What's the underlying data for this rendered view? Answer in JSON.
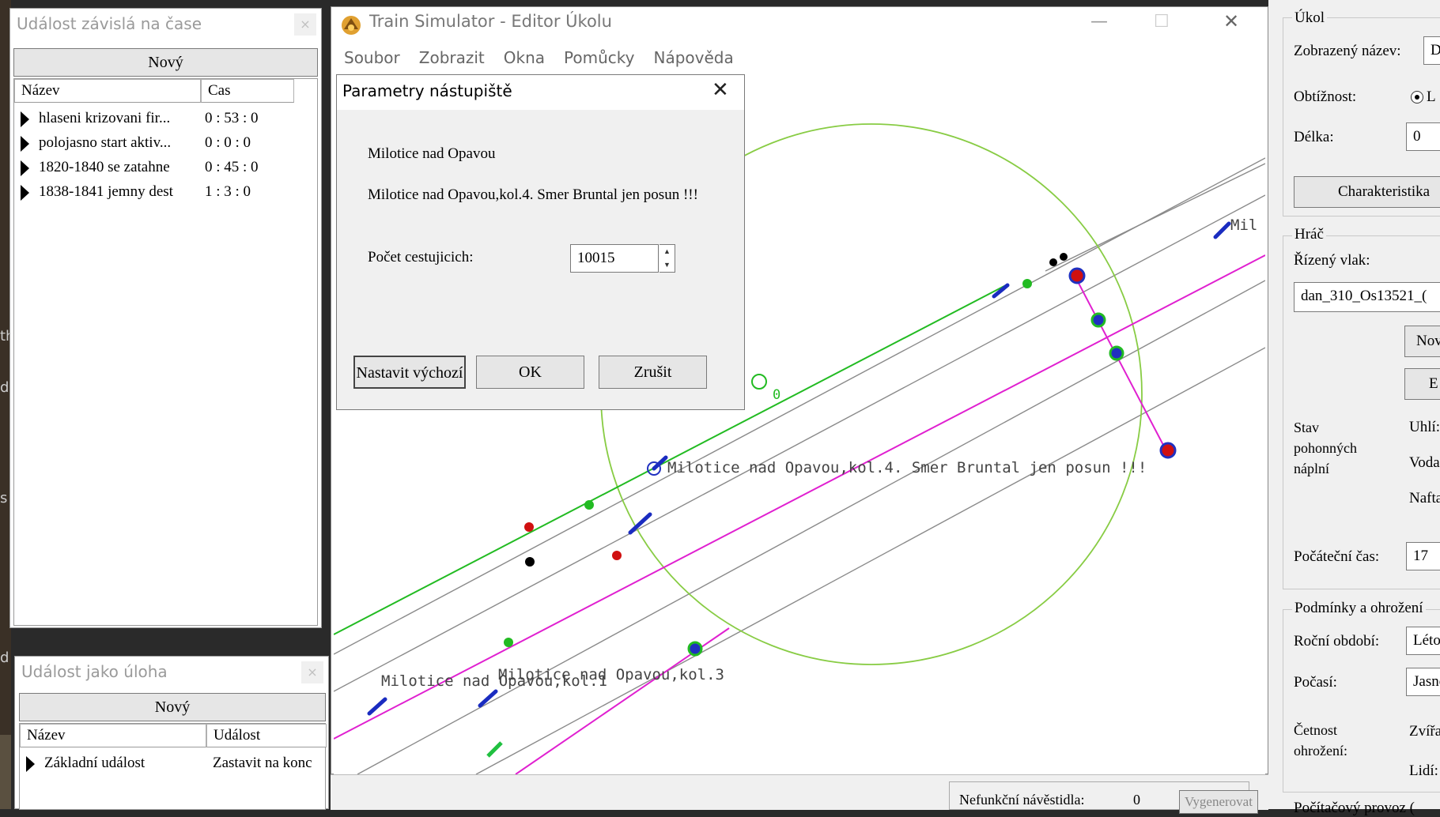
{
  "time_event_window": {
    "title": "Událost závislá na čase",
    "close_label": "×",
    "new_button": "Nový",
    "columns": [
      "Název",
      "Cas"
    ],
    "rows": [
      {
        "name": "hlaseni krizovani fir...",
        "time": "0 : 53 : 0"
      },
      {
        "name": "polojasno start aktiv...",
        "time": "0 : 0 : 0"
      },
      {
        "name": "1820-1840 se zatahne",
        "time": "0 : 45 : 0"
      },
      {
        "name": "1838-1841 jemny dest",
        "time": "1 : 3 : 0"
      }
    ]
  },
  "task_event_window": {
    "title": "Událost jako úloha",
    "close_label": "×",
    "new_button": "Nový",
    "columns": [
      "Název",
      "Událost"
    ],
    "rows": [
      {
        "name": "Základní událost",
        "event": "Zastavit na konc"
      }
    ]
  },
  "background_texts": {
    "left_edge_a": "d",
    "left_edge_b": "th",
    "left_edge_c": "s",
    "left_edge_d": "d"
  },
  "main_window": {
    "title": "Train Simulator - Editor Úkolu",
    "minimize": "—",
    "maximize": "☐",
    "close": "✕",
    "menu": [
      "Soubor",
      "Zobrazit",
      "Okna",
      "Pomůcky",
      "Nápověda"
    ]
  },
  "map": {
    "labels": {
      "platform_4": "Milotice nad Opavou,kol.4. Smer Bruntal jen posun !!!",
      "platform_3": "Milotice nad Opavou,kol.3",
      "platform_1": "Milotice nad Opavou,kol.1",
      "right_clip": "Mil",
      "zero": "0"
    },
    "colors": {
      "green": "#22bb22",
      "magenta": "#e020d0",
      "grey": "#8a8a8a",
      "circle": "#88cc44",
      "blue": "#2030c0",
      "red": "#d01010"
    }
  },
  "platform_dialog": {
    "title": "Parametry nástupiště",
    "close": "✕",
    "station_name": "Milotice nad Opavou",
    "description": "Milotice nad Opavou,kol.4. Smer Bruntal jen posun !!!",
    "passengers_label": "Počet cestujicich:",
    "passengers_value": "10015",
    "btn_default": "Nastavit výchozí",
    "btn_ok": "OK",
    "btn_cancel": "Zrušit"
  },
  "right_panel": {
    "group_task": "Úkol",
    "display_name_label": "Zobrazený název:",
    "display_name_value": "D",
    "difficulty_label": "Obtížnost:",
    "difficulty_option": "L",
    "length_label": "Délka:",
    "length_value": "0",
    "characteristics_button": "Charakteristika",
    "group_player": "Hráč",
    "driven_train_label": "Řízený vlak:",
    "driven_train_value": "dan_310_Os13521_(",
    "new_button": "Nov",
    "edit_button": "E",
    "fuel_state_label": "Stav pohonných náplní",
    "coal_label": "Uhlí:",
    "water_label": "Voda:",
    "diesel_label": "Nafta",
    "start_time_label": "Počáteční čas:",
    "start_time_value": "17",
    "group_conditions": "Podmínky a ohrožení",
    "season_label": "Roční období:",
    "season_value": "Léto",
    "weather_label": "Počasí:",
    "weather_value": "Jasnc",
    "threat_freq_label": "Četnost ohrožení:",
    "animals_label": "Zvířa",
    "people_label": "Lidí:",
    "bottom_clip": "Počítačový provoz ("
  },
  "bottom_bar": {
    "nonfunctional_label": "Nefunkční návěstidla:",
    "nonfunctional_value": "0",
    "generate_button": "Vygenerovat"
  }
}
